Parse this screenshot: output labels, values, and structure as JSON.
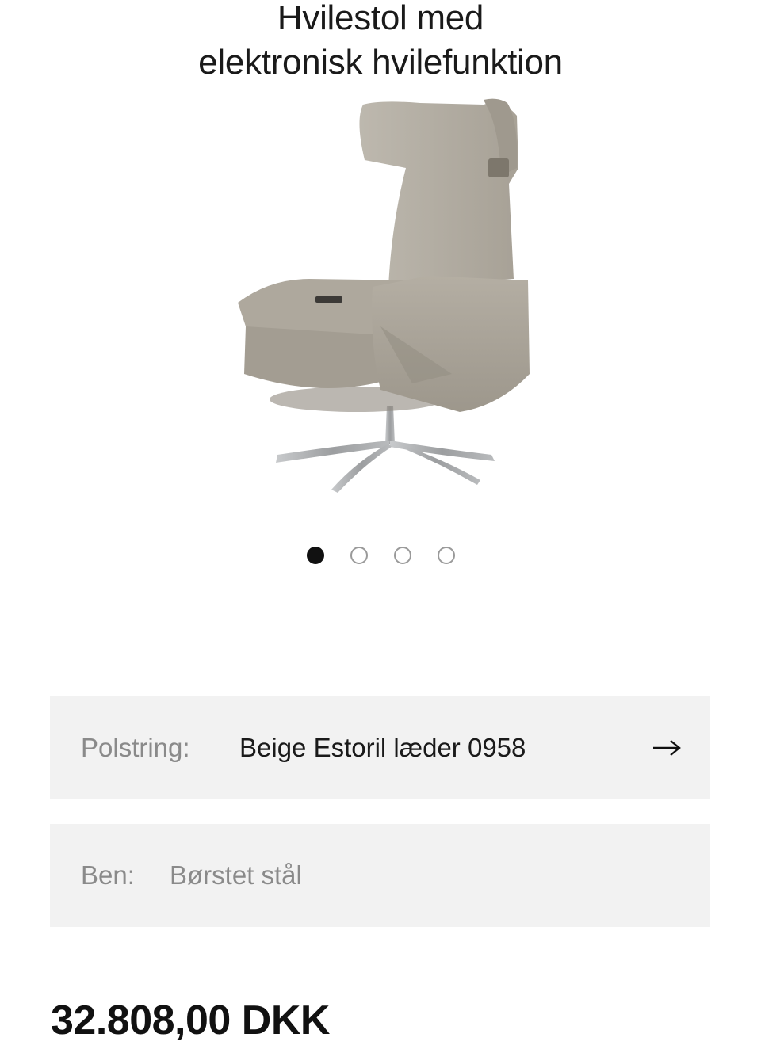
{
  "product": {
    "title_line1": "Hvilestol med",
    "title_line2": "elektronisk hvilefunktion",
    "image_icon": "recliner-chair-image",
    "colors": {
      "upholstery": "#b3ada2",
      "base_metal": "#a9abad"
    }
  },
  "carousel": {
    "total": 4,
    "active_index": 0
  },
  "options": {
    "upholstery": {
      "label": "Polstring:",
      "value": "Beige Estoril læder 0958",
      "icon": "arrow-right-icon"
    },
    "legs": {
      "label": "Ben:",
      "value": "Børstet stål"
    }
  },
  "price": {
    "text": "32.808,00 DKK"
  }
}
